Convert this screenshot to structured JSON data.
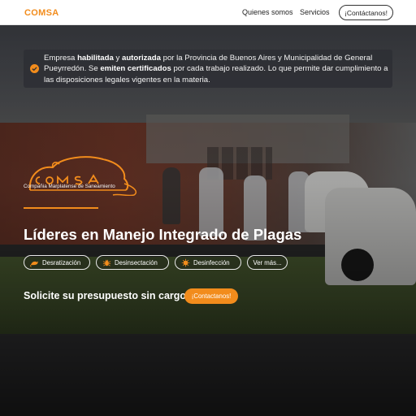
{
  "header": {
    "brand": "COMSA",
    "nav": {
      "about": "Quienes somos",
      "services": "Servicios",
      "contact": "¡Contáctanos!"
    }
  },
  "notice": {
    "icon": "check-circle-icon",
    "segments": {
      "s1": "Empresa ",
      "b1": "habilitada",
      "s2": " y ",
      "b2": "autorizada",
      "s3": " por la Provincia de Buenos Aires y Municipalidad de General Pueyrredón. Se ",
      "b3": "emiten certificados",
      "s4": " por cada trabajo realizado. Lo que permite dar cumplimiento a las disposiciones legales vigentes en la materia."
    }
  },
  "logo": {
    "wordmark": "COMSA",
    "subtitle": "Compañia Marplatense de Saneamiento"
  },
  "hero": {
    "headline": "Líderes en Manejo Integrado de Plagas",
    "services": [
      {
        "label": "Desratización",
        "icon": "rat-icon"
      },
      {
        "label": "Desinsectación",
        "icon": "bug-icon"
      },
      {
        "label": "Desinfección",
        "icon": "virus-icon"
      },
      {
        "label": "Ver más..."
      }
    ],
    "quote_text": "Solicite su presupuesto sin cargo",
    "quote_button": "¡Contactanos!"
  },
  "colors": {
    "accent": "#f28c1c",
    "header_bg": "#ffffff",
    "notice_bg": "#2d2f34"
  }
}
